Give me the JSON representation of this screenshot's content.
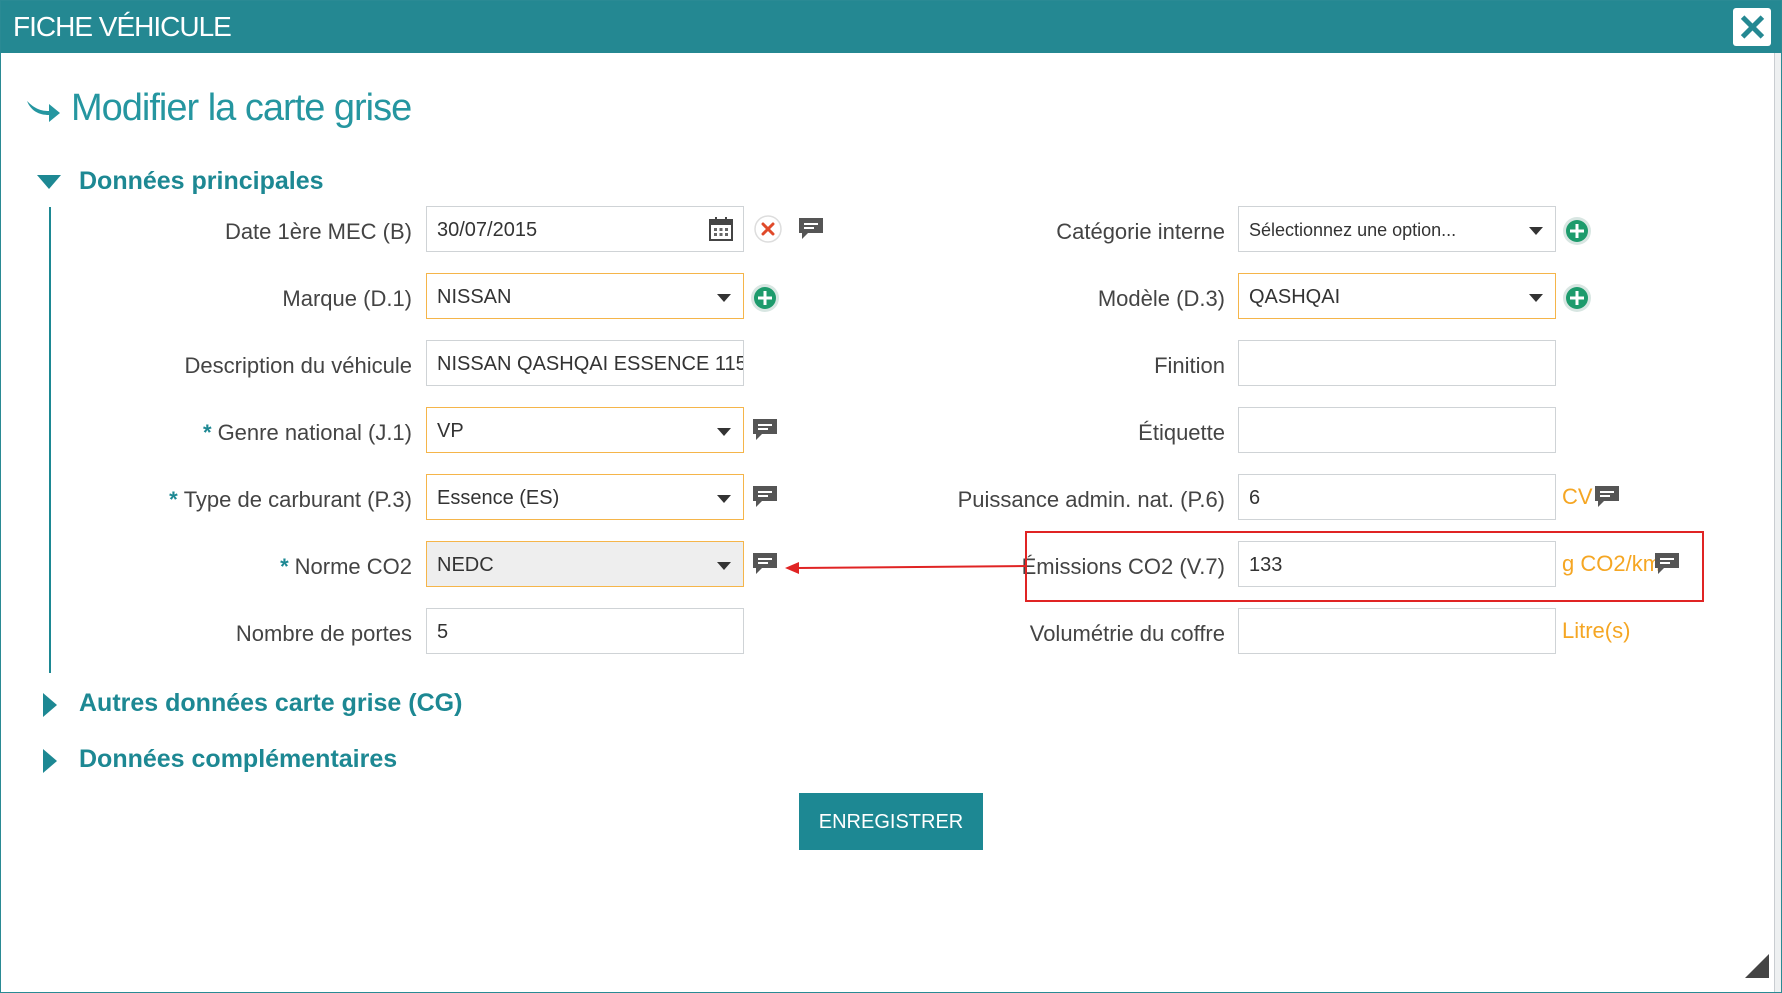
{
  "window": {
    "title": "FICHE VÉHICULE"
  },
  "page": {
    "title": "Modifier la carte grise"
  },
  "sections": {
    "main": "Données principales",
    "other_cg": "Autres données carte grise (CG)",
    "extra": "Données complémentaires"
  },
  "left_fields": {
    "date_mec": {
      "label": "Date 1ère MEC (B)",
      "value": "30/07/2015"
    },
    "marque": {
      "label": "Marque (D.1)",
      "value": "NISSAN"
    },
    "description": {
      "label": "Description du véhicule",
      "value": "NISSAN QASHQAI ESSENCE 115"
    },
    "genre": {
      "label": "Genre national (J.1)",
      "value": "VP"
    },
    "carburant": {
      "label": "Type de carburant (P.3)",
      "value": "Essence (ES)"
    },
    "norme_co2": {
      "label": "Norme CO2",
      "value": "NEDC"
    },
    "portes": {
      "label": "Nombre de portes",
      "value": "5"
    }
  },
  "right_fields": {
    "categorie": {
      "label": "Catégorie interne",
      "value": "Sélectionnez une option..."
    },
    "modele": {
      "label": "Modèle (D.3)",
      "value": "QASHQAI"
    },
    "finition": {
      "label": "Finition",
      "value": ""
    },
    "etiquette": {
      "label": "Étiquette",
      "value": ""
    },
    "puissance": {
      "label": "Puissance admin. nat. (P.6)",
      "value": "6",
      "unit": "CV"
    },
    "emissions": {
      "label": "Émissions CO2 (V.7)",
      "value": "133",
      "unit": "g CO2/km"
    },
    "coffre": {
      "label": "Volumétrie du coffre",
      "value": "",
      "unit": "Litre(s)"
    }
  },
  "required_marker": "*",
  "actions": {
    "save": "ENREGISTRER"
  },
  "colors": {
    "teal": "#248892",
    "orange": "#f5a623",
    "green": "#1d9b6c",
    "red": "#e02424"
  }
}
